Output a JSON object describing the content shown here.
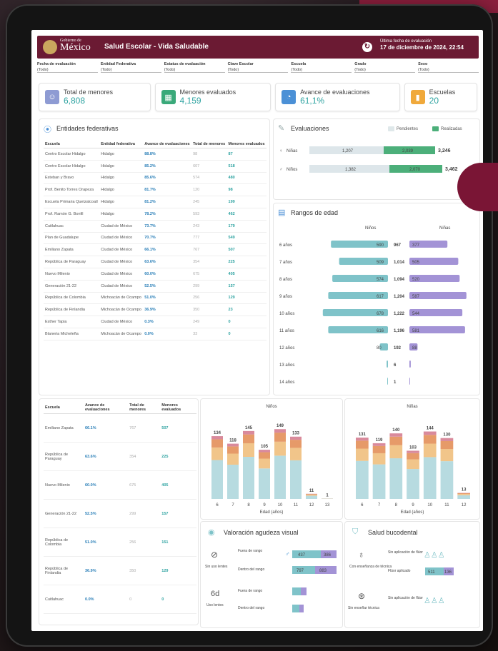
{
  "header": {
    "logo_line1": "Gobierno de",
    "logo_line2": "México",
    "title": "Salud Escolar - Vida Saludable",
    "last_label": "Última fecha de evaluación",
    "last_date": "17 de diciembre de 2024, 22:54"
  },
  "filters": [
    {
      "label": "Fecha de evaluación",
      "value": "(Todo)"
    },
    {
      "label": "Entidad Federativa",
      "value": "(Todo)"
    },
    {
      "label": "Estatus de evaluación",
      "value": "(Todo)"
    },
    {
      "label": "Clave Escolar",
      "value": "(Todo)"
    },
    {
      "label": "Escuela",
      "value": "(Todo)"
    },
    {
      "label": "Grado",
      "value": "(Todo)"
    },
    {
      "label": "Sexo",
      "value": "(Todo)"
    }
  ],
  "kpis": [
    {
      "label": "Total de menores",
      "value": "6,808",
      "icon": "child-icon",
      "color": "#8e9bd3"
    },
    {
      "label": "Menores evaluados",
      "value": "4,159",
      "icon": "grid-icon",
      "color": "#3aa97a"
    },
    {
      "label": "Avance de evaluaciones",
      "value": "61,1%",
      "icon": "pie-icon",
      "color": "#4b90d6"
    },
    {
      "label": "Escuelas",
      "value": "20",
      "icon": "school-icon",
      "color": "#f0a93b"
    }
  ],
  "entidades": {
    "title": "Entidades federativas",
    "columns": [
      "Escuela",
      "Entidad federativa",
      "Avance de evaluaciones",
      "Total de menores",
      "Menores evaluados"
    ],
    "rows": [
      [
        "Centro Escolar Hidalgo",
        "Hidalgo",
        "88.8%",
        "98",
        "87"
      ],
      [
        "Centro Escolar Hidalgo",
        "Hidalgo",
        "85.2%",
        "607",
        "518"
      ],
      [
        "Esteban y Bravo",
        "Hidalgo",
        "85.6%",
        "574",
        "480"
      ],
      [
        "Prof. Benito Torres Orapeza",
        "Hidalgo",
        "81.7%",
        "120",
        "98"
      ],
      [
        "Escuela Primaria Quetzalcoatl",
        "Hidalgo",
        "81.2%",
        "245",
        "199"
      ],
      [
        "Prof. Ramón G. Bonfil",
        "Hidalgo",
        "78.2%",
        "593",
        "462"
      ],
      [
        "Cuitlahuac",
        "Ciudad de México",
        "73.7%",
        "243",
        "179"
      ],
      [
        "Plan de Guadalupe",
        "Ciudad de México",
        "70.7%",
        "777",
        "549"
      ],
      [
        "Emiliano Zapata",
        "Ciudad de México",
        "66.1%",
        "767",
        "507"
      ],
      [
        "República de Paraguay",
        "Ciudad de México",
        "63.6%",
        "354",
        "225"
      ],
      [
        "Nuevo Milenio",
        "Ciudad de México",
        "60.0%",
        "675",
        "405"
      ],
      [
        "Generación 21-22",
        "Ciudad de México",
        "52.5%",
        "299",
        "157"
      ],
      [
        "República de Colombia",
        "Michoacán de Ocampo",
        "51.0%",
        "256",
        "129"
      ],
      [
        "República de Finlandia",
        "Michoacán de Ocampo",
        "36.9%",
        "350",
        "23"
      ],
      [
        "Esther Tapia",
        "Ciudad de México",
        "0.3%",
        "249",
        "0"
      ],
      [
        "Blaneria Micheleña",
        "Michoacán de Ocampo",
        "0.0%",
        "33",
        "0"
      ]
    ]
  },
  "evaluaciones": {
    "title": "Evaluaciones",
    "legend_pending": "Pendientes",
    "legend_done": "Realizadas",
    "rows": [
      {
        "label": "Niñas",
        "pending": "1,207",
        "done": "2,039",
        "total": "3,246"
      },
      {
        "label": "Niños",
        "pending": "1,382",
        "done": "2,070",
        "total": "3,462"
      }
    ]
  },
  "rangos": {
    "title": "Rangos de edad",
    "left_label": "Niños",
    "right_label": "Niñas",
    "rows": [
      {
        "age": "6 años",
        "boys": "590",
        "total": "967",
        "girls": "377",
        "bw": 0.42,
        "gw": 0.28
      },
      {
        "age": "7 años",
        "boys": "509",
        "total": "1,014",
        "girls": "505",
        "bw": 0.36,
        "gw": 0.36
      },
      {
        "age": "8 años",
        "boys": "574",
        "total": "1,094",
        "girls": "520",
        "bw": 0.41,
        "gw": 0.37
      },
      {
        "age": "9 años",
        "boys": "617",
        "total": "1,204",
        "girls": "587",
        "bw": 0.44,
        "gw": 0.42
      },
      {
        "age": "10 años",
        "boys": "678",
        "total": "1,222",
        "girls": "544",
        "bw": 0.48,
        "gw": 0.39
      },
      {
        "age": "11 años",
        "boys": "616",
        "total": "1,196",
        "girls": "581",
        "bw": 0.44,
        "gw": 0.41
      },
      {
        "age": "12 años",
        "boys": "80",
        "total": "192",
        "girls": "88",
        "bw": 0.06,
        "gw": 0.06
      },
      {
        "age": "13 años",
        "boys": "",
        "total": "6",
        "girls": "",
        "bw": 0.01,
        "gw": 0.01
      },
      {
        "age": "14 años",
        "boys": "",
        "total": "1",
        "girls": "",
        "bw": 0.005,
        "gw": 0.005
      }
    ]
  },
  "escuelas2": {
    "columns": [
      "Escuela",
      "Avance de evaluaciones",
      "Total de menores",
      "Menores evaluados"
    ],
    "rows": [
      [
        "Emiliano Zapata",
        "66.1%",
        "767",
        "507"
      ],
      [
        "República de Paraguay",
        "63.6%",
        "354",
        "225"
      ],
      [
        "Nuevo Milenio",
        "60.0%",
        "675",
        "405"
      ],
      [
        "Generación 21-22",
        "52.5%",
        "299",
        "157"
      ],
      [
        "República de Colombia",
        "51.0%",
        "256",
        "151"
      ],
      [
        "República de Finlandia",
        "36.9%",
        "350",
        "129"
      ],
      [
        "Cuitlahuac",
        "0.0%",
        "0",
        "0"
      ]
    ]
  },
  "chart_data": [
    {
      "type": "bar",
      "title": "Niños",
      "xlabel": "Edad (años)",
      "categories": [
        "6",
        "7",
        "8",
        "9",
        "10",
        "11",
        "12",
        "13"
      ],
      "values": [
        134,
        118,
        145,
        105,
        149,
        133,
        11,
        1
      ],
      "ylim": [
        0,
        160
      ],
      "colors": [
        "#b7dbe0",
        "#f1c58a",
        "#e69a69",
        "#d98a9c"
      ]
    },
    {
      "type": "bar",
      "title": "Niñas",
      "xlabel": "Edad (años)",
      "categories": [
        "6",
        "7",
        "8",
        "9",
        "10",
        "11",
        "12"
      ],
      "values": [
        131,
        119,
        140,
        103,
        144,
        130,
        13
      ],
      "ylim": [
        0,
        160
      ],
      "colors": [
        "#b7dbe0",
        "#f1c58a",
        "#e69a69",
        "#d98a9c"
      ]
    }
  ],
  "agudeza": {
    "title": "Valoración agudeza visual",
    "group1": "Sin uso lentes",
    "group2": "Uso lentes",
    "r1": "Fuera de rango",
    "r2": "Dentro del rango",
    "bar1a": "437",
    "bar1b": "386",
    "bar2a": "797",
    "bar2b": "883"
  },
  "bucodental": {
    "title": "Salud bucodental",
    "g1": "Con enseñanza de técnica",
    "g2": "Sin enseñar técnica",
    "r1": "Sin aplicación de flúor",
    "r2": "Flúor aplicado",
    "r3": "Sin aplicación de flúor",
    "b2a": "511",
    "b2b": "136"
  },
  "colors": {
    "brand": "#6b1a33",
    "teal": "#7fc3c9",
    "green": "#4caf7a",
    "lilac": "#a393d6"
  }
}
